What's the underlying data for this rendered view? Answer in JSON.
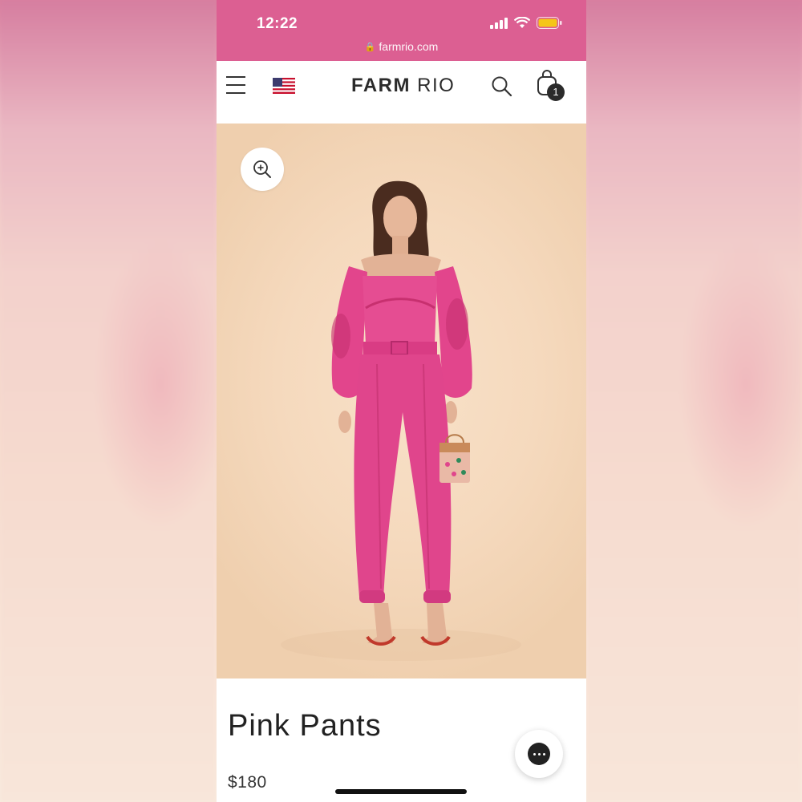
{
  "status_bar": {
    "time": "12:22",
    "url": "farmrio.com",
    "icons": [
      "signal-icon",
      "wifi-icon",
      "battery-icon"
    ],
    "background_color": "#dc5f92"
  },
  "nav": {
    "menu_icon": "hamburger-menu-icon",
    "flag_icon": "us-flag-icon",
    "logo_primary": "FARM",
    "logo_secondary": "RIO",
    "search_icon": "search-icon",
    "bag_icon": "shopping-bag-icon",
    "bag_count": "1"
  },
  "product": {
    "zoom_icon": "zoom-in-icon",
    "title": "Pink Pants",
    "price": "$180",
    "accent_color": "#e0468d"
  },
  "chat": {
    "icon": "chat-bubble-icon"
  }
}
